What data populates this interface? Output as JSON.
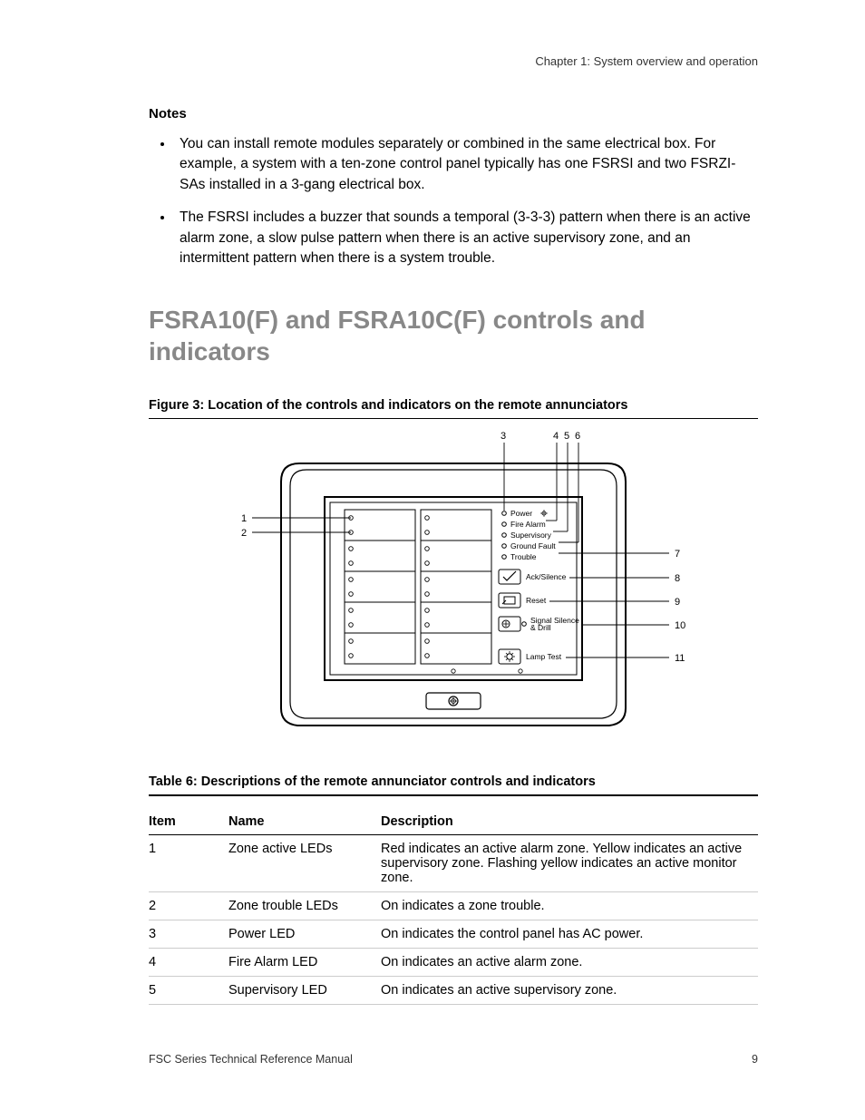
{
  "chapter_header": "Chapter 1: System overview and operation",
  "notes_heading": "Notes",
  "notes": [
    "You can install remote modules separately or combined in the same electrical box. For example, a system with a ten-zone control panel typically has one FSRSI and two FSRZI-SAs installed in a 3-gang electrical box.",
    "The FSRSI includes a buzzer that sounds a temporal (3-3-3) pattern when there is an active alarm zone, a slow pulse pattern when there is an active supervisory zone, and an intermittent pattern when there is a system trouble."
  ],
  "section_title": "FSRA10(F) and FSRA10C(F) controls and indicators",
  "figure_caption": "Figure 3: Location of the controls and indicators on the remote annunciators",
  "figure": {
    "callouts_left": [
      "1",
      "2"
    ],
    "callouts_top": [
      "3",
      "4",
      "5",
      "6"
    ],
    "callouts_right": [
      "7",
      "8",
      "9",
      "10",
      "11"
    ],
    "status_leds": [
      "Power",
      "Fire Alarm",
      "Supervisory",
      "Ground Fault",
      "Trouble"
    ],
    "buttons": [
      "Ack/Silence",
      "Reset",
      "Signal Silence & Drill",
      "Lamp Test"
    ]
  },
  "table_caption": "Table 6: Descriptions of the remote annunciator controls and indicators",
  "table": {
    "headers": [
      "Item",
      "Name",
      "Description"
    ],
    "rows": [
      {
        "item": "1",
        "name": "Zone active LEDs",
        "desc": "Red indicates an active alarm zone. Yellow indicates an active supervisory zone. Flashing yellow indicates an active monitor zone."
      },
      {
        "item": "2",
        "name": "Zone trouble LEDs",
        "desc": "On indicates a zone trouble."
      },
      {
        "item": "3",
        "name": "Power LED",
        "desc": "On indicates the control panel has AC power."
      },
      {
        "item": "4",
        "name": "Fire Alarm LED",
        "desc": "On indicates an active alarm zone."
      },
      {
        "item": "5",
        "name": "Supervisory LED",
        "desc": "On indicates an active supervisory zone."
      }
    ]
  },
  "footer_left": "FSC Series Technical Reference Manual",
  "footer_right": "9"
}
